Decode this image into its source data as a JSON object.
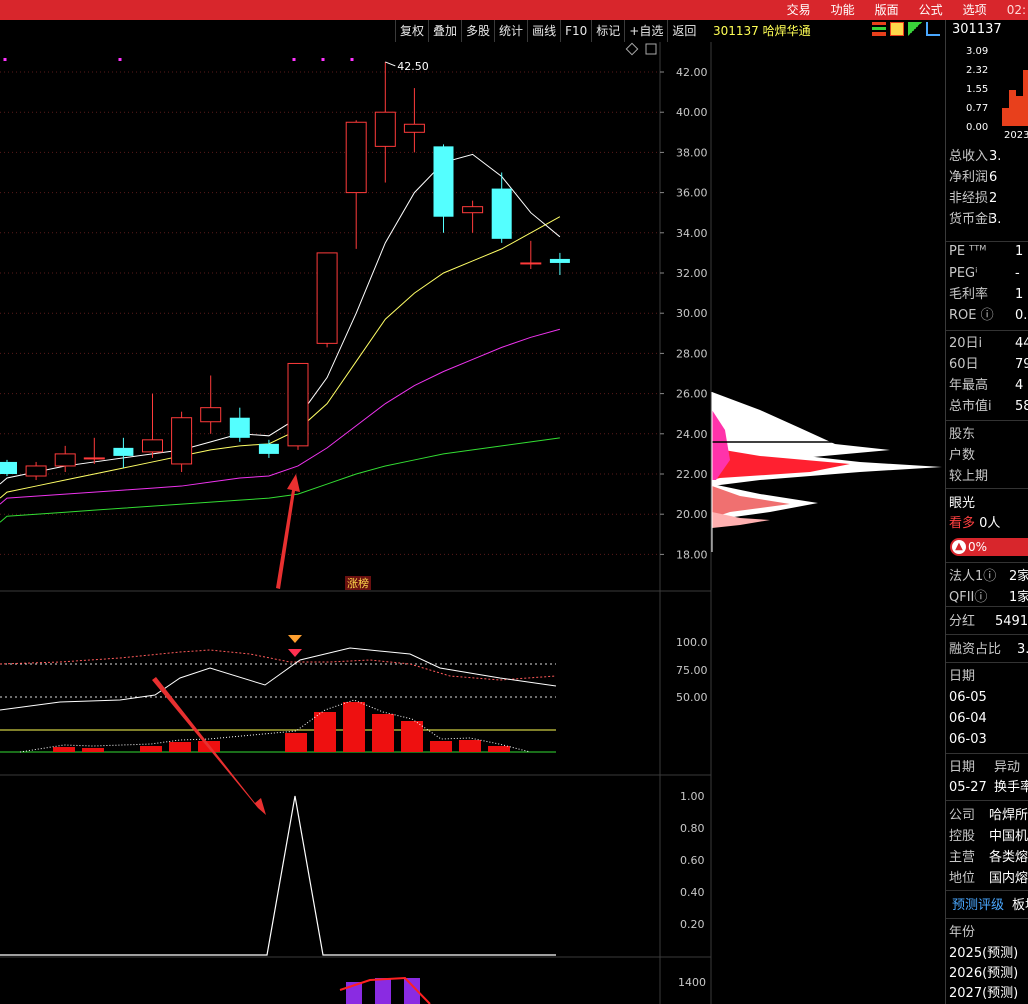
{
  "top_menu": [
    "交易",
    "功能",
    "版面",
    "公式",
    "选项"
  ],
  "clock": "02:",
  "toolbar": [
    "复权",
    "叠加",
    "多股",
    "统计",
    "画线",
    "F10",
    "标记",
    "+自选",
    "返回"
  ],
  "stock_header": "301137 哈焊华通",
  "main_chart": {
    "y_ticks": [
      "42.00",
      "40.00",
      "38.00",
      "36.00",
      "34.00",
      "32.00",
      "30.00",
      "28.00",
      "26.00",
      "24.00",
      "22.00",
      "20.00",
      "18.00"
    ],
    "high_marker": "42.50",
    "limit_up_label": "涨榜",
    "candles": [
      {
        "o": 22.0,
        "c": 22.6,
        "h": 22.7,
        "l": 21.9,
        "up": false
      },
      {
        "o": 21.9,
        "c": 22.4,
        "h": 22.6,
        "l": 21.7,
        "up": true
      },
      {
        "o": 22.4,
        "c": 23.0,
        "h": 23.4,
        "l": 22.1,
        "up": true
      },
      {
        "o": 22.8,
        "c": 22.8,
        "h": 23.8,
        "l": 22.5,
        "up": true
      },
      {
        "o": 23.3,
        "c": 22.9,
        "h": 23.8,
        "l": 22.3,
        "up": false
      },
      {
        "o": 23.1,
        "c": 23.7,
        "h": 26.0,
        "l": 22.8,
        "up": true
      },
      {
        "o": 22.5,
        "c": 24.8,
        "h": 25.1,
        "l": 22.1,
        "up": true
      },
      {
        "o": 24.6,
        "c": 25.3,
        "h": 26.9,
        "l": 24.0,
        "up": true
      },
      {
        "o": 24.8,
        "c": 23.8,
        "h": 25.3,
        "l": 23.6,
        "up": false
      },
      {
        "o": 23.5,
        "c": 23.0,
        "h": 23.7,
        "l": 22.8,
        "up": false
      },
      {
        "o": 23.4,
        "c": 27.5,
        "h": 27.5,
        "l": 23.2,
        "up": true
      },
      {
        "o": 28.5,
        "c": 33.0,
        "h": 33.0,
        "l": 28.3,
        "up": true
      },
      {
        "o": 36.0,
        "c": 39.5,
        "h": 39.6,
        "l": 33.2,
        "up": true
      },
      {
        "o": 38.3,
        "c": 40.0,
        "h": 42.5,
        "l": 36.5,
        "up": true
      },
      {
        "o": 39.0,
        "c": 39.4,
        "h": 41.2,
        "l": 38.0,
        "up": true
      },
      {
        "o": 38.3,
        "c": 34.8,
        "h": 38.4,
        "l": 34.0,
        "up": false
      },
      {
        "o": 35.0,
        "c": 35.3,
        "h": 35.6,
        "l": 34.0,
        "up": true
      },
      {
        "o": 36.2,
        "c": 33.7,
        "h": 37.0,
        "l": 33.5,
        "up": false
      },
      {
        "o": 32.5,
        "c": 32.5,
        "h": 33.6,
        "l": 32.2,
        "up": true
      },
      {
        "o": 32.7,
        "c": 32.5,
        "h": 33.0,
        "l": 31.9,
        "up": false
      }
    ],
    "ma_white": [
      21.8,
      22.1,
      22.4,
      22.6,
      22.8,
      23.0,
      23.2,
      23.6,
      24.0,
      23.9,
      24.8,
      26.8,
      30.0,
      33.5,
      36.0,
      37.5,
      37.9,
      36.8,
      35.0,
      33.8
    ],
    "ma_yellow": [
      21.1,
      21.4,
      21.7,
      22.0,
      22.3,
      22.6,
      22.9,
      23.2,
      23.4,
      23.5,
      24.2,
      25.5,
      27.6,
      29.7,
      31.0,
      32.0,
      32.6,
      33.2,
      34.0,
      34.8
    ],
    "ma_magenta": [
      20.8,
      20.9,
      21.0,
      21.1,
      21.2,
      21.3,
      21.4,
      21.6,
      21.8,
      21.9,
      22.4,
      23.3,
      24.4,
      25.5,
      26.4,
      27.1,
      27.7,
      28.3,
      28.8,
      29.2
    ],
    "ma_green": [
      19.9,
      20.0,
      20.1,
      20.2,
      20.3,
      20.4,
      20.5,
      20.6,
      20.7,
      20.8,
      21.0,
      21.5,
      22.0,
      22.4,
      22.7,
      23.0,
      23.2,
      23.4,
      23.6,
      23.8
    ]
  },
  "indicator1": {
    "y_ticks": [
      "100.0",
      "75.00",
      "50.00"
    ]
  },
  "indicator2": {
    "y_ticks": [
      "1.00",
      "0.80",
      "0.60",
      "0.40",
      "0.20"
    ]
  },
  "indicator3": {
    "y_ticks": [
      "1400"
    ]
  },
  "right_panel": {
    "code": "301137",
    "mini_chart_ticks": [
      "3.09",
      "2.32",
      "1.55",
      "0.77",
      "0.00"
    ],
    "mini_chart_year": "2023",
    "rows": [
      {
        "label": "总收入",
        "value": "3."
      },
      {
        "label": "净利润",
        "value": "6"
      },
      {
        "label": "非经损",
        "value": "2"
      },
      {
        "label": "货币金i",
        "value": "3."
      },
      {
        "label": "PE ᵀᵀᴹ",
        "value": "1"
      },
      {
        "label": "PEGⁱ",
        "value": "-"
      },
      {
        "label": "毛利率",
        "value": "1"
      },
      {
        "label": "ROE ⓘ",
        "value": "0."
      },
      {
        "label": "20日i",
        "value": "44"
      },
      {
        "label": "60日",
        "value": "79"
      },
      {
        "label": "年最高",
        "value": "4"
      },
      {
        "label": "总市值i",
        "value": "58."
      },
      {
        "label": "股东",
        "value": ""
      },
      {
        "label": "户数",
        "value": ""
      },
      {
        "label": "较上期",
        "value": ""
      }
    ],
    "eye": "眼光",
    "kanduo": "看多",
    "kanduo_val": "0人",
    "hot_pct": "0%",
    "inst_rows": [
      {
        "label": "法人1ⓘ",
        "value": "2家"
      },
      {
        "label": "QFIIⓘ",
        "value": "1家"
      },
      {
        "label": "分红",
        "value": "5491"
      },
      {
        "label": "融资占比",
        "value": "3."
      }
    ],
    "date_header": "日期",
    "dates": [
      "06-05",
      "06-04",
      "06-03"
    ],
    "date_header2": "日期",
    "abn_header": "异动",
    "abn_date": "05-27",
    "abn_val": "换手率",
    "company_rows": [
      {
        "label": "公司",
        "value": "哈焊所"
      },
      {
        "label": "控股",
        "value": "中国机"
      },
      {
        "label": "主营",
        "value": "各类熔"
      },
      {
        "label": "地位",
        "value": "国内熔"
      }
    ],
    "forecast": "预测评级",
    "board": "板块",
    "year_label": "年份",
    "years": [
      "2025(预测)",
      "2026(预测)",
      "2027(预测)"
    ]
  },
  "colors": {
    "up": "#ff3b3b",
    "down": "#54ffff",
    "accent": "#d8262c"
  }
}
